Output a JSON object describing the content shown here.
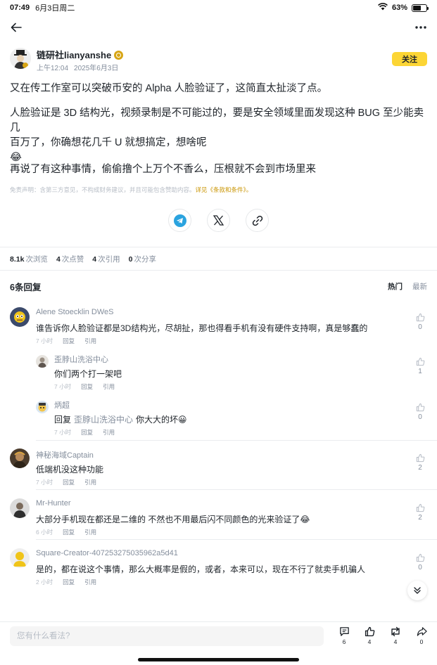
{
  "status_bar": {
    "time": "07:49",
    "date": "6月3日周二",
    "battery": "63%",
    "battery_level": 0.63
  },
  "author": {
    "name": "链研社lianyanshe",
    "time": "上午12:04",
    "date": "2025年6月3日",
    "follow_label": "关注"
  },
  "post": {
    "paragraph1": "又在传工作室可以突破币安的 Alpha 人脸验证了，这简直太扯淡了点。",
    "paragraph2_line1": "人脸验证是 3D 结构光，视频录制是不可能过的，要是安全领域里面发现这种 BUG 至少能卖几",
    "paragraph2_line2": "百万了，你确想花几千 U 就想搞定，想啥呢",
    "paragraph2_emoji": "😂",
    "paragraph3": "再说了有这种事情，偷偷撸个上万个不香么，压根就不会到市场里来",
    "disclaimer": "免责声明：含第三方意见，不构成财务建议，并且可能包含赞助内容。",
    "disclaimer_link": "详见《条款和条件》。"
  },
  "stats": {
    "views_count": "8.1k",
    "views_label": "次浏览",
    "likes_count": "4",
    "likes_label": "次点赞",
    "quotes_count": "4",
    "quotes_label": "次引用",
    "shares_count": "0",
    "shares_label": "次分享"
  },
  "replies": {
    "title": "6条回复",
    "sort_hot": "热门",
    "sort_new": "最新",
    "reply_label": "回复",
    "quote_label": "引用",
    "items": [
      {
        "name": "Alene Stoecklin DWeS",
        "text": "谁告诉你人脸验证都是3D结构光，尽胡扯，那也得看手机有没有硬件支持啊，真是够蠢的",
        "time": "7 小时",
        "likes": "0"
      },
      {
        "name": "歪脖山洗浴中心",
        "text": "你们两个打一架吧",
        "time": "7 小时",
        "likes": "1"
      },
      {
        "name": "炳超",
        "reply_prefix": "回复",
        "reply_target": "歪脖山洗浴中心",
        "text": "你大大的坏😀",
        "time": "7 小时",
        "likes": "0"
      },
      {
        "name": "神秘海域Captain",
        "text": "低端机没这种功能",
        "time": "7 小时",
        "likes": "2"
      },
      {
        "name": "Mr-Hunter",
        "text": "大部分手机现在都还是二维的 不然也不用最后闪不同颜色的光来验证了😂",
        "time": "6 小时",
        "likes": "2"
      },
      {
        "name": "Square-Creator-407253275035962a5d41",
        "text": "是的，都在说这个事情，那么大概率是假的，或者，本来可以，现在不行了就卖手机骗人",
        "time": "2 小时",
        "likes": "0"
      }
    ]
  },
  "bottom_bar": {
    "placeholder": "您有什么看法?",
    "comments": "6",
    "likes": "4",
    "reposts": "4",
    "shares": "0"
  }
}
